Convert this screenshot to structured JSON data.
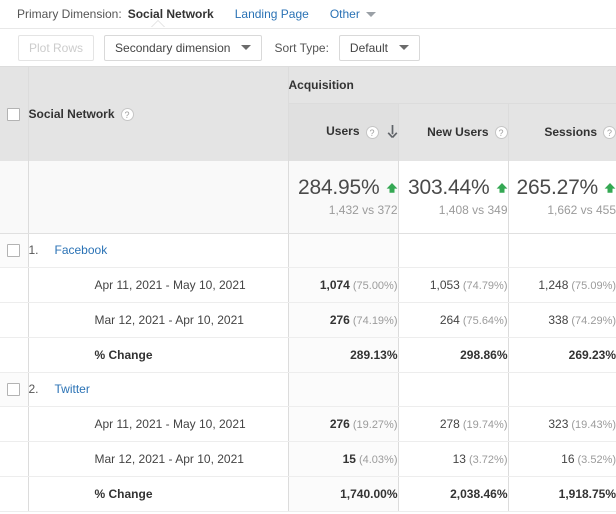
{
  "primary_dimension": {
    "label": "Primary Dimension:",
    "active": "Social Network",
    "links": [
      "Landing Page"
    ],
    "other": "Other",
    "other_icon": "chevron-down-icon"
  },
  "toolbar": {
    "plot_rows": "Plot Rows",
    "secondary_dimension": "Secondary dimension",
    "sort_type_label": "Sort Type:",
    "sort_type_value": "Default",
    "caret_icon": "chevron-down-icon"
  },
  "table": {
    "group_header": "Acquisition",
    "dimension_header": "Social Network",
    "help_icon": "question-mark-icon",
    "checkbox_icon": "checkbox-unchecked-icon",
    "sort_icon": "arrow-down-icon",
    "up_icon": "arrow-up-icon",
    "columns": [
      {
        "label": "Users",
        "sorted": true
      },
      {
        "label": "New Users",
        "sorted": false
      },
      {
        "label": "Sessions",
        "sorted": false
      }
    ],
    "summary": [
      {
        "percent": "284.95%",
        "compare": "1,432 vs 372",
        "direction": "up"
      },
      {
        "percent": "303.44%",
        "compare": "1,408 vs 349",
        "direction": "up"
      },
      {
        "percent": "265.27%",
        "compare": "1,662 vs 455",
        "direction": "up"
      }
    ],
    "groups": [
      {
        "index": "1.",
        "name": "Facebook",
        "rows": [
          {
            "label": "Apr 11, 2021 - May 10, 2021",
            "bold_label": false,
            "cells": [
              {
                "value": "1,074",
                "pct": "(75.00%)"
              },
              {
                "value": "1,053",
                "pct": "(74.79%)"
              },
              {
                "value": "1,248",
                "pct": "(75.09%)"
              }
            ]
          },
          {
            "label": "Mar 12, 2021 - Apr 10, 2021",
            "bold_label": false,
            "cells": [
              {
                "value": "276",
                "pct": "(74.19%)"
              },
              {
                "value": "264",
                "pct": "(75.64%)"
              },
              {
                "value": "338",
                "pct": "(74.29%)"
              }
            ]
          },
          {
            "label": "% Change",
            "bold_label": true,
            "cells": [
              {
                "value": "289.13%",
                "pct": ""
              },
              {
                "value": "298.86%",
                "pct": ""
              },
              {
                "value": "269.23%",
                "pct": ""
              }
            ]
          }
        ]
      },
      {
        "index": "2.",
        "name": "Twitter",
        "rows": [
          {
            "label": "Apr 11, 2021 - May 10, 2021",
            "bold_label": false,
            "cells": [
              {
                "value": "276",
                "pct": "(19.27%)"
              },
              {
                "value": "278",
                "pct": "(19.74%)"
              },
              {
                "value": "323",
                "pct": "(19.43%)"
              }
            ]
          },
          {
            "label": "Mar 12, 2021 - Apr 10, 2021",
            "bold_label": false,
            "cells": [
              {
                "value": "15",
                "pct": "(4.03%)"
              },
              {
                "value": "13",
                "pct": "(3.72%)"
              },
              {
                "value": "16",
                "pct": "(3.52%)"
              }
            ]
          },
          {
            "label": "% Change",
            "bold_label": true,
            "cells": [
              {
                "value": "1,740.00%",
                "pct": ""
              },
              {
                "value": "2,038.46%",
                "pct": ""
              },
              {
                "value": "1,918.75%",
                "pct": ""
              }
            ]
          }
        ]
      }
    ]
  },
  "colors": {
    "link": "#2a72b5",
    "positive": "#34a853",
    "header_bg": "#e4e4e4",
    "summary_bg": "#f9f9f9"
  }
}
